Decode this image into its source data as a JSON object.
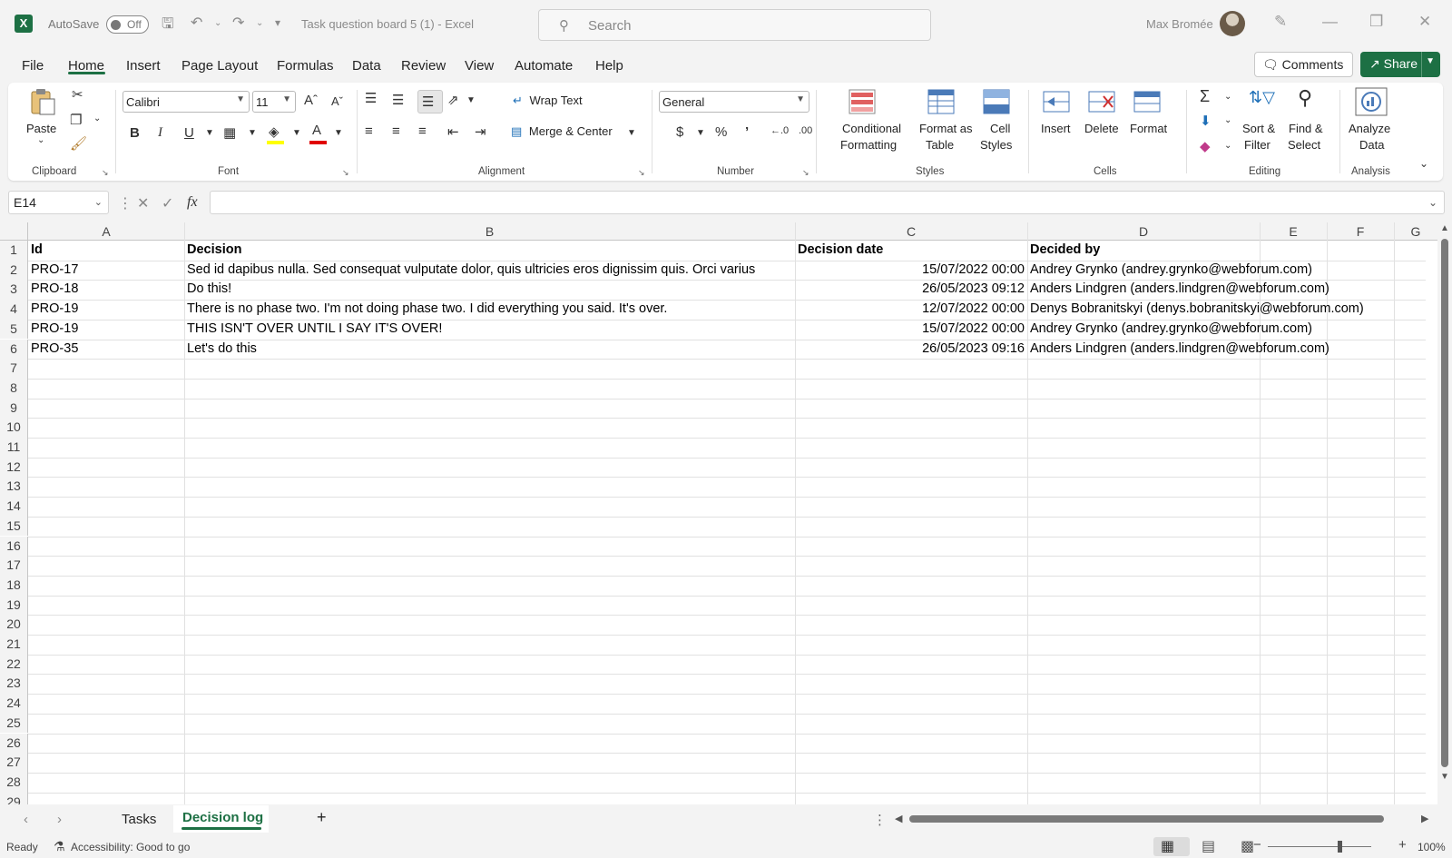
{
  "titlebar": {
    "autosave_label": "AutoSave",
    "autosave_state": "Off",
    "document_title": "Task question board 5 (1)  -  Excel",
    "search_placeholder": "Search",
    "user_name": "Max Bromée"
  },
  "menu": {
    "tabs": [
      "File",
      "Home",
      "Insert",
      "Page Layout",
      "Formulas",
      "Data",
      "Review",
      "View",
      "Automate",
      "Help"
    ],
    "active": "Home",
    "comments_label": "Comments",
    "share_label": "Share"
  },
  "ribbon": {
    "clipboard": {
      "paste": "Paste",
      "label": "Clipboard"
    },
    "font": {
      "name": "Calibri",
      "size": "11",
      "label": "Font",
      "bold": "B",
      "italic": "I",
      "underline": "U"
    },
    "alignment": {
      "wrap_text": "Wrap Text",
      "merge_center": "Merge & Center",
      "label": "Alignment"
    },
    "number": {
      "format": "General",
      "label": "Number"
    },
    "styles": {
      "conditional_1": "Conditional",
      "conditional_2": "Formatting",
      "format_table_1": "Format as",
      "format_table_2": "Table",
      "cell_styles_1": "Cell",
      "cell_styles_2": "Styles",
      "label": "Styles"
    },
    "cells": {
      "insert": "Insert",
      "delete": "Delete",
      "format": "Format",
      "label": "Cells"
    },
    "editing": {
      "sort_1": "Sort &",
      "sort_2": "Filter",
      "find_1": "Find &",
      "find_2": "Select",
      "label": "Editing"
    },
    "analysis": {
      "analyze_1": "Analyze",
      "analyze_2": "Data",
      "label": "Analysis"
    }
  },
  "formula_bar": {
    "name_box": "E14",
    "fx": "fx",
    "content": ""
  },
  "sheet": {
    "columns": [
      "A",
      "B",
      "C",
      "D",
      "E",
      "F",
      "G"
    ],
    "row_numbers": [
      "1",
      "2",
      "3",
      "4",
      "5",
      "6",
      "7",
      "8",
      "9",
      "10",
      "11",
      "12",
      "13",
      "14",
      "15",
      "16",
      "17",
      "18",
      "19",
      "20",
      "21",
      "22",
      "23",
      "24",
      "25",
      "26",
      "27",
      "28",
      "29"
    ],
    "headers": {
      "a": "Id",
      "b": "Decision",
      "c": "Decision date",
      "d": "Decided by"
    },
    "rows": [
      {
        "id": "PRO-17",
        "decision": "Sed id dapibus nulla. Sed consequat vulputate dolor, quis ultricies eros dignissim quis. Orci varius",
        "date": "15/07/2022 00:00",
        "by": "Andrey Grynko (andrey.grynko@webforum.com)"
      },
      {
        "id": "PRO-18",
        "decision": "Do this!",
        "date": "26/05/2023 09:12",
        "by": "Anders Lindgren (anders.lindgren@webforum.com)"
      },
      {
        "id": "PRO-19",
        "decision": "There is no phase two. I'm not doing phase two. I did everything you said. It's over.",
        "date": "12/07/2022 00:00",
        "by": "Denys Bobranitskyi (denys.bobranitskyi@webforum.com)"
      },
      {
        "id": "PRO-19",
        "decision": "THIS ISN'T OVER UNTIL I SAY IT'S OVER!",
        "date": "15/07/2022 00:00",
        "by": "Andrey Grynko (andrey.grynko@webforum.com)"
      },
      {
        "id": "PRO-35",
        "decision": "Let's do this",
        "date": "26/05/2023 09:16",
        "by": "Anders Lindgren (anders.lindgren@webforum.com)"
      }
    ]
  },
  "sheet_tabs": {
    "tabs": [
      "Tasks",
      "Decision log"
    ],
    "active": "Decision log",
    "add_label": "+"
  },
  "status": {
    "ready": "Ready",
    "accessibility": "Accessibility: Good to go",
    "zoom": "100%"
  },
  "colors": {
    "accent": "#1d7044"
  }
}
